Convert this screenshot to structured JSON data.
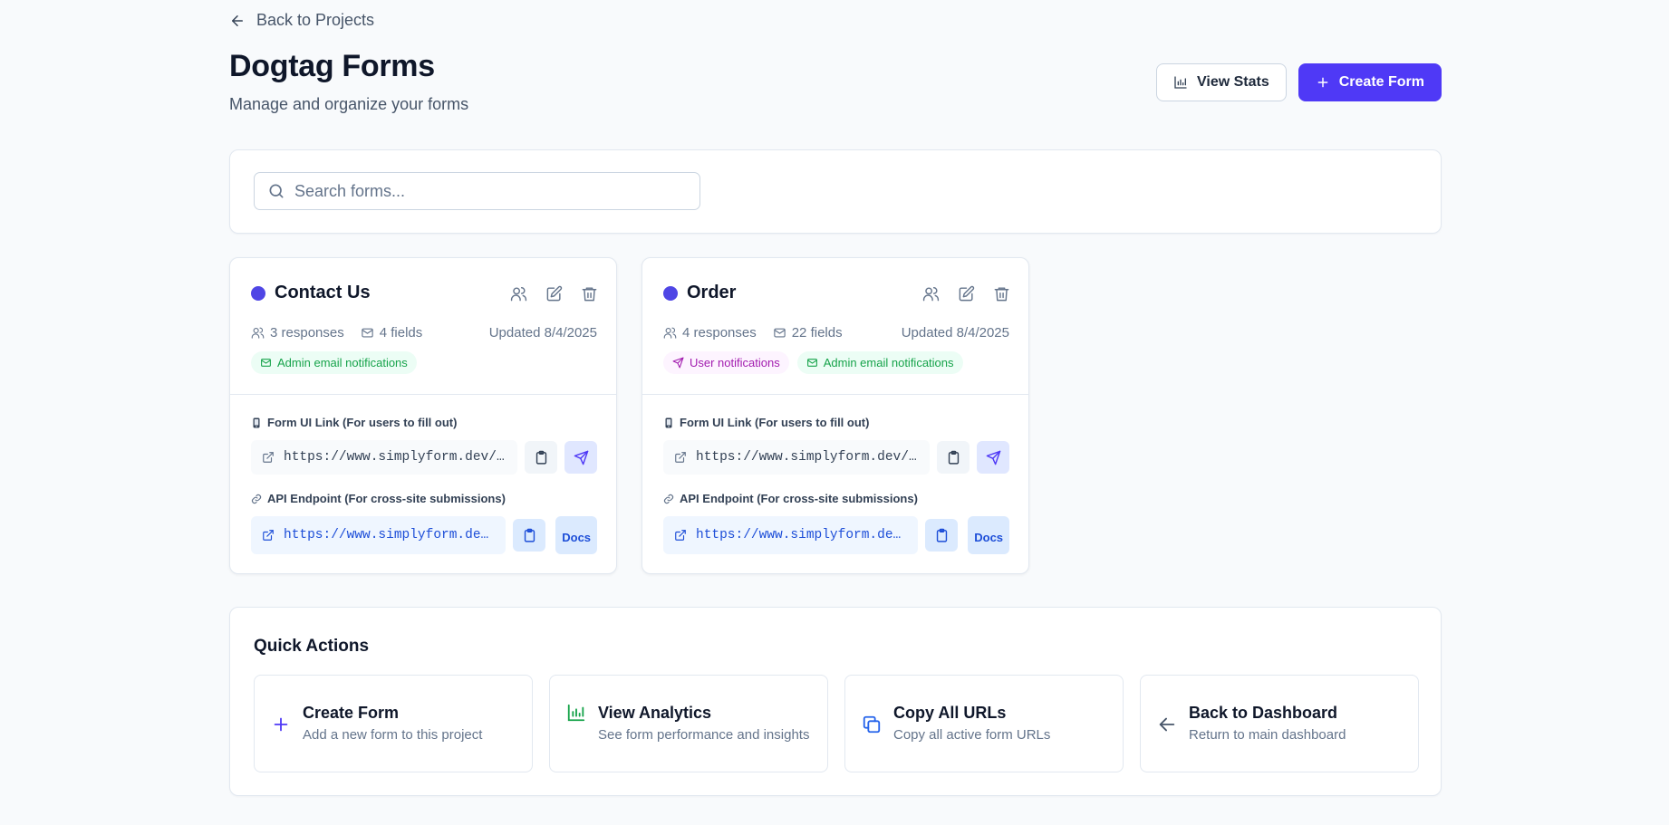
{
  "header": {
    "back_label": "Back to Projects",
    "title": "Dogtag Forms",
    "subtitle": "Manage and organize your forms",
    "view_stats_label": "View Stats",
    "create_form_label": "Create Form"
  },
  "search": {
    "placeholder": "Search forms...",
    "value": ""
  },
  "forms": [
    {
      "name": "Contact Us",
      "responses": "3 responses",
      "fields": "4 fields",
      "updated": "Updated 8/4/2025",
      "badges": [
        "Admin email notifications"
      ],
      "ui_link_label": "Form UI Link (For users to fill out)",
      "ui_url": "https://www.simplyform.dev/…",
      "api_label": "API Endpoint (For cross-site submissions)",
      "api_url": "https://www.simplyform.dev…",
      "docs_label": "Docs"
    },
    {
      "name": "Order",
      "responses": "4 responses",
      "fields": "22 fields",
      "updated": "Updated 8/4/2025",
      "badges": [
        "User notifications",
        "Admin email notifications"
      ],
      "ui_link_label": "Form UI Link (For users to fill out)",
      "ui_url": "https://www.simplyform.dev/…",
      "api_label": "API Endpoint (For cross-site submissions)",
      "api_url": "https://www.simplyform.dev…",
      "docs_label": "Docs"
    }
  ],
  "quick_actions": {
    "title": "Quick Actions",
    "items": [
      {
        "name": "Create Form",
        "description": "Add a new form to this project",
        "icon": "plus-icon"
      },
      {
        "name": "View Analytics",
        "description": "See form performance and insights",
        "icon": "bar-chart-icon"
      },
      {
        "name": "Copy All URLs",
        "description": "Copy all active form URLs",
        "icon": "copy-icon"
      },
      {
        "name": "Back to Dashboard",
        "description": "Return to main dashboard",
        "icon": "arrow-left-icon"
      }
    ]
  },
  "colors": {
    "primary": "#4f39f6",
    "status_dot": "#4f46e5",
    "badge_green": "#16a34a",
    "badge_purple": "#a21caf",
    "api_blue": "#1d4ed8"
  }
}
